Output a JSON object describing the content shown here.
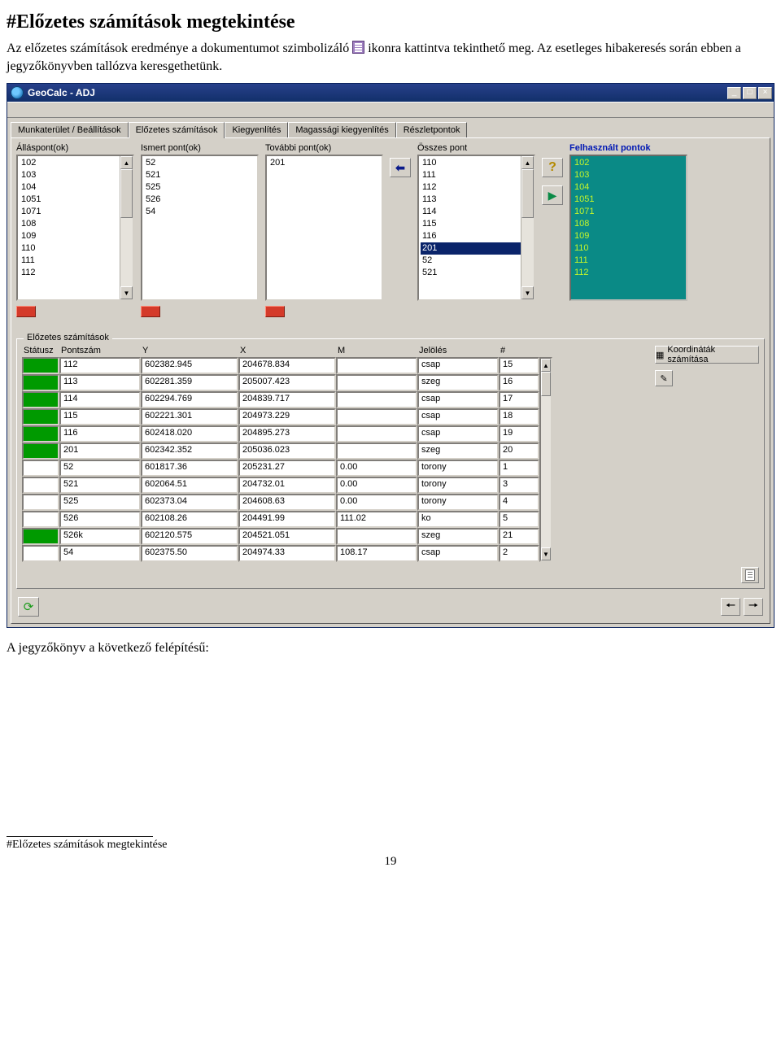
{
  "doc": {
    "heading_prefix": "#",
    "heading": "Előzetes számítások megtekintése",
    "para1a": "Az előzetes számítások eredménye a dokumentumot szimbolizáló ",
    "para1b": " ikonra kattintva tekinthető meg. Az esetleges hibakeresés során ebben a jegyzőkönyvben tallózva keresgethetünk.",
    "para2": "A jegyzőkönyv a következő felépítésű:",
    "footnote": "#Előzetes számítások megtekintése",
    "page": "19"
  },
  "window": {
    "title": "GeoCalc - ADJ",
    "tabs": [
      "Munkaterület / Beállítások",
      "Előzetes számítások",
      "Kiegyenlítés",
      "Magassági kiegyenlítés",
      "Részletpontok"
    ],
    "activeTab": 1,
    "cols": {
      "allas": {
        "label": "Álláspont(ok)",
        "items": [
          "102",
          "103",
          "104",
          "1051",
          "1071",
          "108",
          "109",
          "110",
          "111",
          "112"
        ]
      },
      "ismert": {
        "label": "Ismert pont(ok)",
        "items": [
          "52",
          "521",
          "525",
          "526",
          "54"
        ]
      },
      "tovabbi": {
        "label": "További pont(ok)",
        "items": [
          "201"
        ]
      },
      "osszes": {
        "label": "Összes pont",
        "items": [
          "110",
          "111",
          "112",
          "113",
          "114",
          "115",
          "116",
          "201",
          "52",
          "521"
        ],
        "selected": "201"
      },
      "felhasznalt": {
        "label": "Felhasznált pontok",
        "items": [
          "102",
          "103",
          "104",
          "1051",
          "1071",
          "108",
          "109",
          "110",
          "111",
          "112"
        ]
      }
    },
    "group": {
      "title": "Előzetes számítások",
      "headers": [
        "Státusz",
        "Pontszám",
        "Y",
        "X",
        "M",
        "Jelölés",
        "#"
      ],
      "rows": [
        {
          "st": "g",
          "pt": "112",
          "y": "602382.945",
          "x": "204678.834",
          "m": "",
          "j": "csap",
          "n": "15"
        },
        {
          "st": "g",
          "pt": "113",
          "y": "602281.359",
          "x": "205007.423",
          "m": "",
          "j": "szeg",
          "n": "16"
        },
        {
          "st": "g",
          "pt": "114",
          "y": "602294.769",
          "x": "204839.717",
          "m": "",
          "j": "csap",
          "n": "17"
        },
        {
          "st": "g",
          "pt": "115",
          "y": "602221.301",
          "x": "204973.229",
          "m": "",
          "j": "csap",
          "n": "18"
        },
        {
          "st": "g",
          "pt": "116",
          "y": "602418.020",
          "x": "204895.273",
          "m": "",
          "j": "csap",
          "n": "19"
        },
        {
          "st": "g",
          "pt": "201",
          "y": "602342.352",
          "x": "205036.023",
          "m": "",
          "j": "szeg",
          "n": "20"
        },
        {
          "st": "",
          "pt": "52",
          "y": "601817.36",
          "x": "205231.27",
          "m": "0.00",
          "j": "torony",
          "n": "1"
        },
        {
          "st": "",
          "pt": "521",
          "y": "602064.51",
          "x": "204732.01",
          "m": "0.00",
          "j": "torony",
          "n": "3"
        },
        {
          "st": "",
          "pt": "525",
          "y": "602373.04",
          "x": "204608.63",
          "m": "0.00",
          "j": "torony",
          "n": "4"
        },
        {
          "st": "",
          "pt": "526",
          "y": "602108.26",
          "x": "204491.99",
          "m": "111.02",
          "j": "ko",
          "n": "5"
        },
        {
          "st": "g",
          "pt": "526k",
          "y": "602120.575",
          "x": "204521.051",
          "m": "",
          "j": "szeg",
          "n": "21"
        },
        {
          "st": "",
          "pt": "54",
          "y": "602375.50",
          "x": "204974.33",
          "m": "108.17",
          "j": "csap",
          "n": "2"
        }
      ],
      "calcBtn": "Koordináták számítása"
    }
  }
}
